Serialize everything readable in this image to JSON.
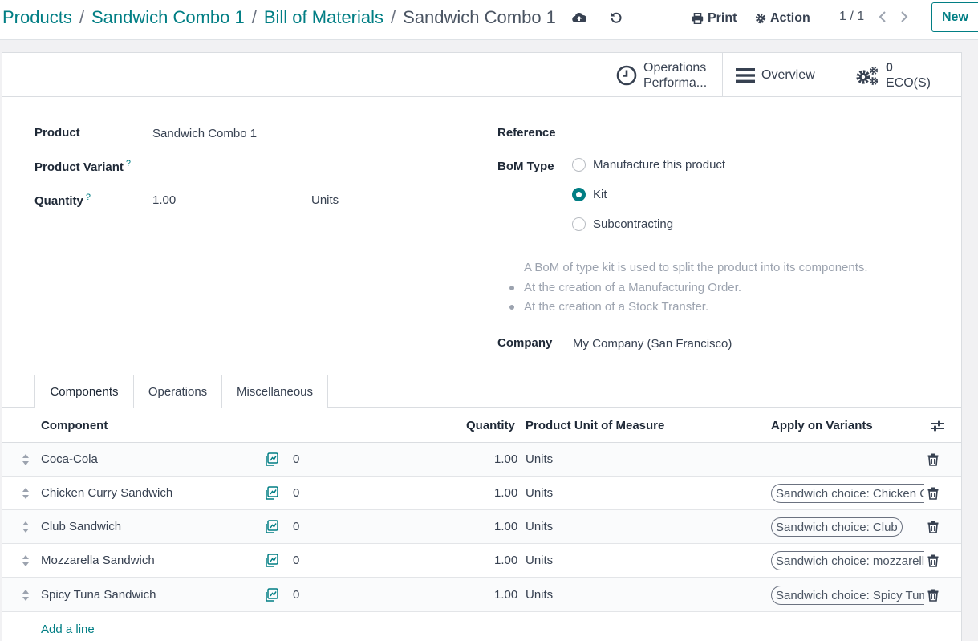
{
  "breadcrumb": {
    "items": [
      "Products",
      "Sandwich Combo 1",
      "Bill of Materials"
    ],
    "current": "Sandwich Combo 1",
    "separator": "/"
  },
  "toolbar": {
    "print_label": "Print",
    "action_label": "Action",
    "pager": "1 / 1",
    "new_label": "New"
  },
  "smart_buttons": {
    "operations_line1": "Operations",
    "operations_line2": "Performa...",
    "overview": "Overview",
    "eco_count": "0",
    "eco_label": "ECO(S)"
  },
  "form": {
    "product_label": "Product",
    "product_value": "Sandwich Combo 1",
    "variant_label": "Product Variant",
    "variant_help": "?",
    "quantity_label": "Quantity",
    "quantity_help": "?",
    "quantity_value": "1.00",
    "quantity_uom": "Units",
    "reference_label": "Reference",
    "bom_type_label": "BoM Type",
    "bom_types": [
      "Manufacture this product",
      "Kit",
      "Subcontracting"
    ],
    "bom_type_selected": "Kit",
    "help_intro": "A BoM of type kit is used to split the product into its components.",
    "help_bullets": [
      "At the creation of a Manufacturing Order.",
      "At the creation of a Stock Transfer."
    ],
    "company_label": "Company",
    "company_value": "My Company (San Francisco)"
  },
  "tabs": [
    "Components",
    "Operations",
    "Miscellaneous"
  ],
  "active_tab": "Components",
  "table": {
    "headers": {
      "component": "Component",
      "quantity": "Quantity",
      "uom": "Product Unit of Measure",
      "variants": "Apply on Variants"
    },
    "rows": [
      {
        "component": "Coca-Cola",
        "forecast": "0",
        "quantity": "1.00",
        "uom": "Units",
        "variant": ""
      },
      {
        "component": "Chicken Curry Sandwich",
        "forecast": "0",
        "quantity": "1.00",
        "uom": "Units",
        "variant": "Sandwich choice: Chicken C"
      },
      {
        "component": "Club Sandwich",
        "forecast": "0",
        "quantity": "1.00",
        "uom": "Units",
        "variant": "Sandwich choice: Club"
      },
      {
        "component": "Mozzarella Sandwich",
        "forecast": "0",
        "quantity": "1.00",
        "uom": "Units",
        "variant": "Sandwich choice: mozzarell"
      },
      {
        "component": "Spicy Tuna Sandwich",
        "forecast": "0",
        "quantity": "1.00",
        "uom": "Units",
        "variant": "Sandwich choice: Spicy Tun"
      }
    ],
    "add_line": "Add a line"
  },
  "colors": {
    "accent": "#017e84",
    "text": "#374151",
    "muted": "#9ca3af"
  }
}
